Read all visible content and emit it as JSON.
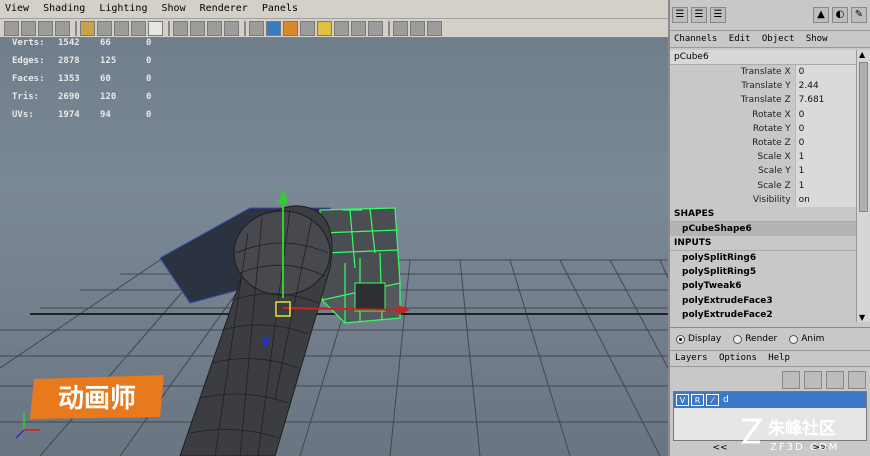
{
  "menubar": [
    "View",
    "Shading",
    "Lighting",
    "Show",
    "Renderer",
    "Panels"
  ],
  "hud": [
    {
      "label": "Verts:",
      "v1": "1542",
      "v2": "66",
      "v3": "0"
    },
    {
      "label": "Edges:",
      "v1": "2878",
      "v2": "125",
      "v3": "0"
    },
    {
      "label": "Faces:",
      "v1": "1353",
      "v2": "60",
      "v3": "0"
    },
    {
      "label": "Tris:",
      "v1": "2690",
      "v2": "120",
      "v3": "0"
    },
    {
      "label": "UVs:",
      "v1": "1974",
      "v2": "94",
      "v3": "0"
    }
  ],
  "channel_menu": [
    "Channels",
    "Edit",
    "Object",
    "Show"
  ],
  "object_name": "pCube6",
  "attributes": [
    {
      "name": "Translate X",
      "value": "0"
    },
    {
      "name": "Translate Y",
      "value": "2.44"
    },
    {
      "name": "Translate Z",
      "value": "7.681"
    },
    {
      "name": "Rotate X",
      "value": "0"
    },
    {
      "name": "Rotate Y",
      "value": "0"
    },
    {
      "name": "Rotate Z",
      "value": "0"
    },
    {
      "name": "Scale X",
      "value": "1"
    },
    {
      "name": "Scale Y",
      "value": "1"
    },
    {
      "name": "Scale Z",
      "value": "1"
    },
    {
      "name": "Visibility",
      "value": "on"
    }
  ],
  "shapes_header": "SHAPES",
  "shape_node": "pCubeShape6",
  "inputs_header": "INPUTS",
  "inputs": [
    "polySplitRing6",
    "polySplitRing5",
    "polyTweak6",
    "polyExtrudeFace3",
    "polyExtrudeFace2"
  ],
  "modes": {
    "display": "Display",
    "render": "Render",
    "anim": "Anim",
    "selected": "display"
  },
  "layer_menu": [
    "Layers",
    "Options",
    "Help"
  ],
  "layer": {
    "v": "V",
    "r": "R",
    "name": "d"
  },
  "nav": {
    "prev": "<<",
    "next": ">>"
  },
  "watermark_left": "动画师",
  "watermark_right": {
    "cn": "朱峰社区",
    "en": "ZF3D.COM"
  },
  "colors": {
    "viewport": "#7b8896",
    "selection": "#33ff66",
    "layer_row": "#3b78c9",
    "panel": "#c8c8c8"
  }
}
